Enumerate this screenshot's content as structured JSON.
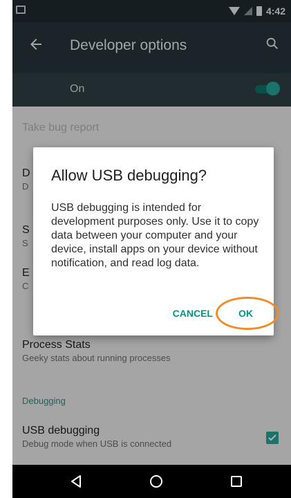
{
  "status_bar": {
    "time": "4:42"
  },
  "app_bar": {
    "title": "Developer options"
  },
  "master_switch": {
    "label": "On"
  },
  "list": {
    "bug_report": "Take bug report",
    "partial_items": [
      {
        "title_initial": "D",
        "subtitle_initial": "D"
      },
      {
        "title_initial": "S",
        "subtitle_initial": "S"
      },
      {
        "title_initial": "E",
        "subtitle_initial": "C"
      }
    ],
    "process_stats": {
      "title": "Process Stats",
      "subtitle": "Geeky stats about running processes"
    },
    "debugging_section": "Debugging",
    "usb_debugging": {
      "title": "USB debugging",
      "subtitle": "Debug mode when USB is connected",
      "checked": true
    }
  },
  "dialog": {
    "title": "Allow USB debugging?",
    "body": "USB debugging is intended for development purposes only. Use it to copy data between your computer and your device, install apps on your device without notification, and read log data.",
    "cancel_label": "CANCEL",
    "ok_label": "OK"
  },
  "colors": {
    "accent": "#009688",
    "highlight": "#f28c28"
  },
  "icons": [
    "back-arrow-icon",
    "search-icon",
    "nav-back-icon",
    "nav-home-icon",
    "nav-recents-icon",
    "wifi-icon",
    "signal-icon",
    "battery-icon",
    "notification-icon",
    "checkbox-checked-icon"
  ]
}
